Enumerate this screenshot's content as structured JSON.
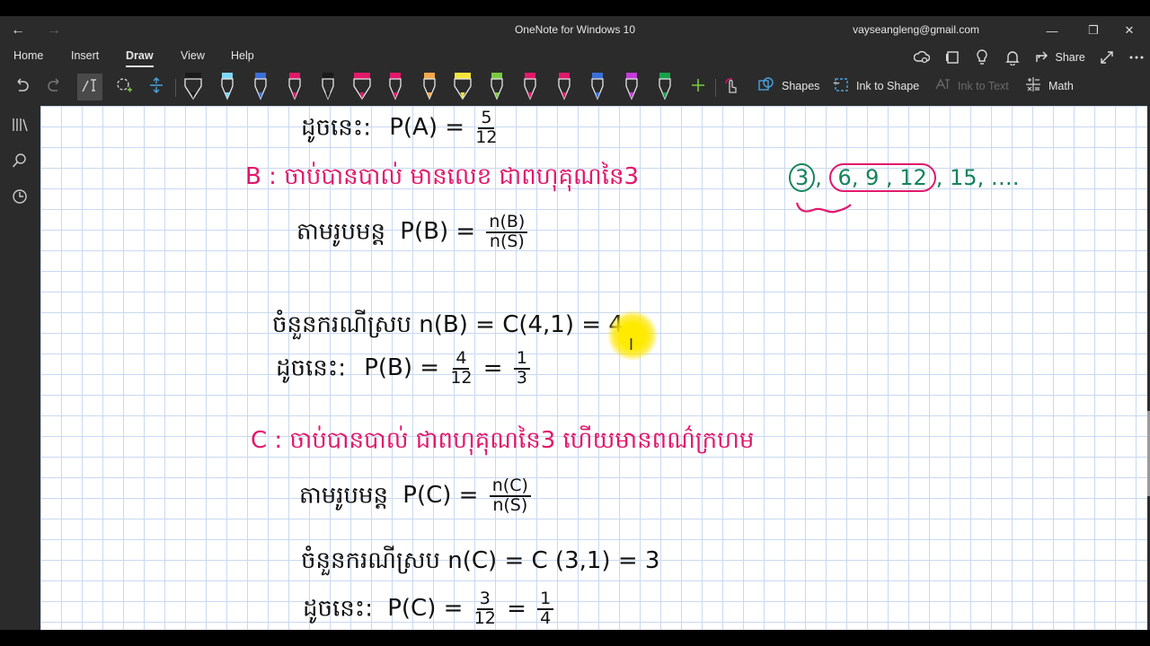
{
  "window": {
    "back": "←",
    "forward": "→",
    "title": "OneNote for Windows 10",
    "account": "vayseangleng@gmail.com",
    "controls": [
      "—",
      "❐",
      "✕"
    ]
  },
  "menu": {
    "tabs": [
      "Home",
      "Insert",
      "Draw",
      "View",
      "Help"
    ],
    "active": "Draw",
    "share_label": "Share"
  },
  "toolbar": {
    "pen_colors": [
      "#1a1a1a",
      "#7fd7f7",
      "#3b6fd8",
      "#e2186b",
      "#1a1a1a",
      "#e2186b",
      "#e2186b",
      "#f0a84a",
      "#f3e53a",
      "#7ac943",
      "#e2186b",
      "#e2186b",
      "#3b6fd8",
      "#c43bd8",
      "#16a34a"
    ],
    "shapes_label": "Shapes",
    "ink_to_shape_label": "Ink to Shape",
    "ink_to_text_label": "Ink to Text",
    "math_label": "Math"
  },
  "content": {
    "line_a": {
      "prefix": "ដូចនេះ:",
      "expr": "P(A) =",
      "num": "5",
      "den": "12"
    },
    "line_b_title": "B : ចាប់បានបាល់ មានលេខ ជាពហុគុណនៃ3",
    "line_b_formula": {
      "prefix": "តាមរូបមន្ត",
      "expr": "P(B) =",
      "num": "n(B)",
      "den": "n(S)"
    },
    "line_b_count": "ចំនួនករណីស្រប  n(B) = C(4,1) = 4",
    "line_b_result": {
      "prefix": "ដូចនេះ:",
      "expr": "P(B) =",
      "num1": "4",
      "den1": "12",
      "eq": "=",
      "num2": "1",
      "den2": "3"
    },
    "side_note_circled": "3",
    "side_note_ringed": "6, 9 , 12",
    "side_note_tail": ", 15, ….",
    "line_c_title": "C : ចាប់បានបាល់ ជាពហុគុណនៃ3  ហើយមានពណ៌ក្រហម",
    "line_c_formula": {
      "prefix": "តាមរូបមន្ត",
      "expr": "P(C) =",
      "num": "n(C)",
      "den": "n(S)"
    },
    "line_c_count": "ចំនួនករណីស្រប n(C) = C (3,1) = 3",
    "line_c_result": {
      "prefix": "ដូចនេះ:",
      "expr": "P(C) =",
      "num1": "3",
      "den1": "12",
      "eq": "=",
      "num2": "1",
      "den2": "4"
    }
  }
}
